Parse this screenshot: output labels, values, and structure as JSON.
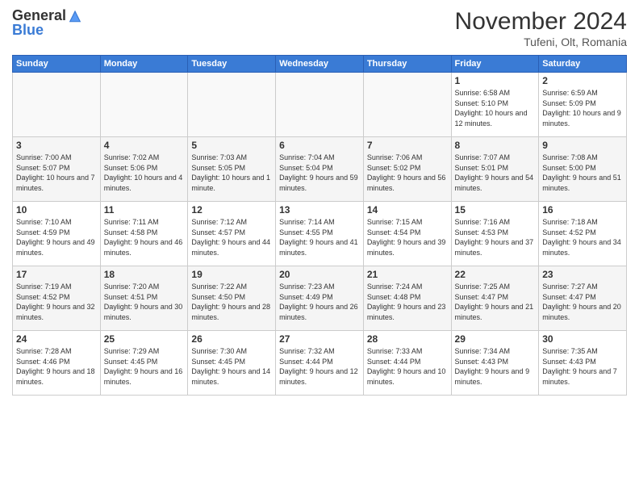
{
  "header": {
    "logo_general": "General",
    "logo_blue": "Blue",
    "month_title": "November 2024",
    "location": "Tufeni, Olt, Romania"
  },
  "weekdays": [
    "Sunday",
    "Monday",
    "Tuesday",
    "Wednesday",
    "Thursday",
    "Friday",
    "Saturday"
  ],
  "weeks": [
    [
      {
        "day": "",
        "info": ""
      },
      {
        "day": "",
        "info": ""
      },
      {
        "day": "",
        "info": ""
      },
      {
        "day": "",
        "info": ""
      },
      {
        "day": "",
        "info": ""
      },
      {
        "day": "1",
        "info": "Sunrise: 6:58 AM\nSunset: 5:10 PM\nDaylight: 10 hours and 12 minutes."
      },
      {
        "day": "2",
        "info": "Sunrise: 6:59 AM\nSunset: 5:09 PM\nDaylight: 10 hours and 9 minutes."
      }
    ],
    [
      {
        "day": "3",
        "info": "Sunrise: 7:00 AM\nSunset: 5:07 PM\nDaylight: 10 hours and 7 minutes."
      },
      {
        "day": "4",
        "info": "Sunrise: 7:02 AM\nSunset: 5:06 PM\nDaylight: 10 hours and 4 minutes."
      },
      {
        "day": "5",
        "info": "Sunrise: 7:03 AM\nSunset: 5:05 PM\nDaylight: 10 hours and 1 minute."
      },
      {
        "day": "6",
        "info": "Sunrise: 7:04 AM\nSunset: 5:04 PM\nDaylight: 9 hours and 59 minutes."
      },
      {
        "day": "7",
        "info": "Sunrise: 7:06 AM\nSunset: 5:02 PM\nDaylight: 9 hours and 56 minutes."
      },
      {
        "day": "8",
        "info": "Sunrise: 7:07 AM\nSunset: 5:01 PM\nDaylight: 9 hours and 54 minutes."
      },
      {
        "day": "9",
        "info": "Sunrise: 7:08 AM\nSunset: 5:00 PM\nDaylight: 9 hours and 51 minutes."
      }
    ],
    [
      {
        "day": "10",
        "info": "Sunrise: 7:10 AM\nSunset: 4:59 PM\nDaylight: 9 hours and 49 minutes."
      },
      {
        "day": "11",
        "info": "Sunrise: 7:11 AM\nSunset: 4:58 PM\nDaylight: 9 hours and 46 minutes."
      },
      {
        "day": "12",
        "info": "Sunrise: 7:12 AM\nSunset: 4:57 PM\nDaylight: 9 hours and 44 minutes."
      },
      {
        "day": "13",
        "info": "Sunrise: 7:14 AM\nSunset: 4:55 PM\nDaylight: 9 hours and 41 minutes."
      },
      {
        "day": "14",
        "info": "Sunrise: 7:15 AM\nSunset: 4:54 PM\nDaylight: 9 hours and 39 minutes."
      },
      {
        "day": "15",
        "info": "Sunrise: 7:16 AM\nSunset: 4:53 PM\nDaylight: 9 hours and 37 minutes."
      },
      {
        "day": "16",
        "info": "Sunrise: 7:18 AM\nSunset: 4:52 PM\nDaylight: 9 hours and 34 minutes."
      }
    ],
    [
      {
        "day": "17",
        "info": "Sunrise: 7:19 AM\nSunset: 4:52 PM\nDaylight: 9 hours and 32 minutes."
      },
      {
        "day": "18",
        "info": "Sunrise: 7:20 AM\nSunset: 4:51 PM\nDaylight: 9 hours and 30 minutes."
      },
      {
        "day": "19",
        "info": "Sunrise: 7:22 AM\nSunset: 4:50 PM\nDaylight: 9 hours and 28 minutes."
      },
      {
        "day": "20",
        "info": "Sunrise: 7:23 AM\nSunset: 4:49 PM\nDaylight: 9 hours and 26 minutes."
      },
      {
        "day": "21",
        "info": "Sunrise: 7:24 AM\nSunset: 4:48 PM\nDaylight: 9 hours and 23 minutes."
      },
      {
        "day": "22",
        "info": "Sunrise: 7:25 AM\nSunset: 4:47 PM\nDaylight: 9 hours and 21 minutes."
      },
      {
        "day": "23",
        "info": "Sunrise: 7:27 AM\nSunset: 4:47 PM\nDaylight: 9 hours and 20 minutes."
      }
    ],
    [
      {
        "day": "24",
        "info": "Sunrise: 7:28 AM\nSunset: 4:46 PM\nDaylight: 9 hours and 18 minutes."
      },
      {
        "day": "25",
        "info": "Sunrise: 7:29 AM\nSunset: 4:45 PM\nDaylight: 9 hours and 16 minutes."
      },
      {
        "day": "26",
        "info": "Sunrise: 7:30 AM\nSunset: 4:45 PM\nDaylight: 9 hours and 14 minutes."
      },
      {
        "day": "27",
        "info": "Sunrise: 7:32 AM\nSunset: 4:44 PM\nDaylight: 9 hours and 12 minutes."
      },
      {
        "day": "28",
        "info": "Sunrise: 7:33 AM\nSunset: 4:44 PM\nDaylight: 9 hours and 10 minutes."
      },
      {
        "day": "29",
        "info": "Sunrise: 7:34 AM\nSunset: 4:43 PM\nDaylight: 9 hours and 9 minutes."
      },
      {
        "day": "30",
        "info": "Sunrise: 7:35 AM\nSunset: 4:43 PM\nDaylight: 9 hours and 7 minutes."
      }
    ]
  ]
}
